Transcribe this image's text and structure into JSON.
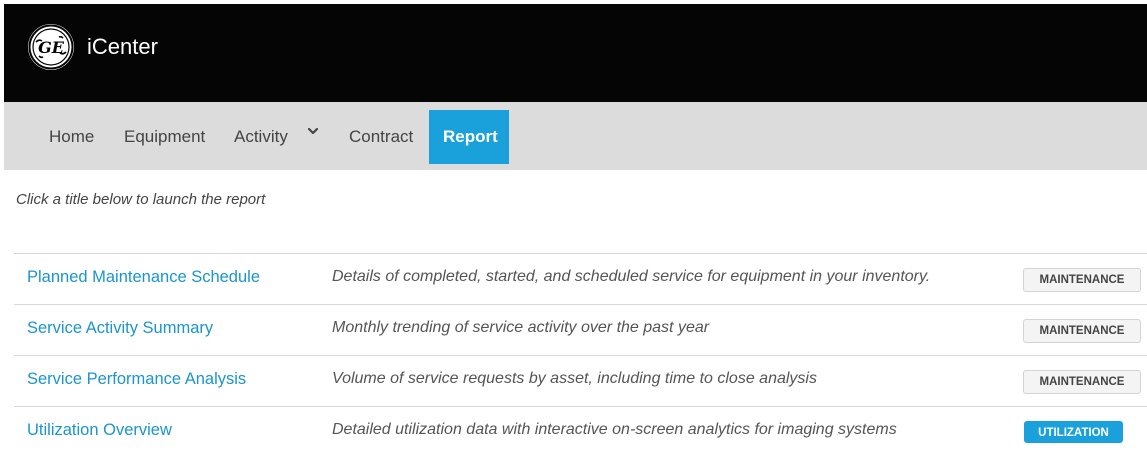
{
  "header": {
    "logo_text": "GE",
    "app_title": "iCenter"
  },
  "nav": {
    "items": [
      {
        "label": "Home"
      },
      {
        "label": "Equipment"
      },
      {
        "label": "Activity"
      },
      {
        "label": "Contract"
      },
      {
        "label": "Report",
        "active": true
      }
    ]
  },
  "main": {
    "intro": "Click a title below to launch the report",
    "reports": [
      {
        "title": "Planned Maintenance Schedule",
        "description": "Details of completed, started, and scheduled service for equipment in your inventory.",
        "tag": "MAINTENANCE"
      },
      {
        "title": "Service Activity Summary",
        "description": "Monthly trending of service activity over the past year",
        "tag": "MAINTENANCE"
      },
      {
        "title": "Service Performance Analysis",
        "description": "Volume of service requests by asset, including time to close analysis",
        "tag": "MAINTENANCE"
      },
      {
        "title": "Utilization Overview",
        "description": "Detailed utilization data with interactive on-screen analytics for imaging systems",
        "tag": "UTILIZATION"
      }
    ]
  },
  "colors": {
    "header_bg": "#050505",
    "nav_bg": "#dcdcdc",
    "accent": "#1aa0db",
    "link": "#1a95cf"
  },
  "icons": {
    "logo": "ge-monogram-logo",
    "activity_dropdown": "chevron-down-icon"
  }
}
